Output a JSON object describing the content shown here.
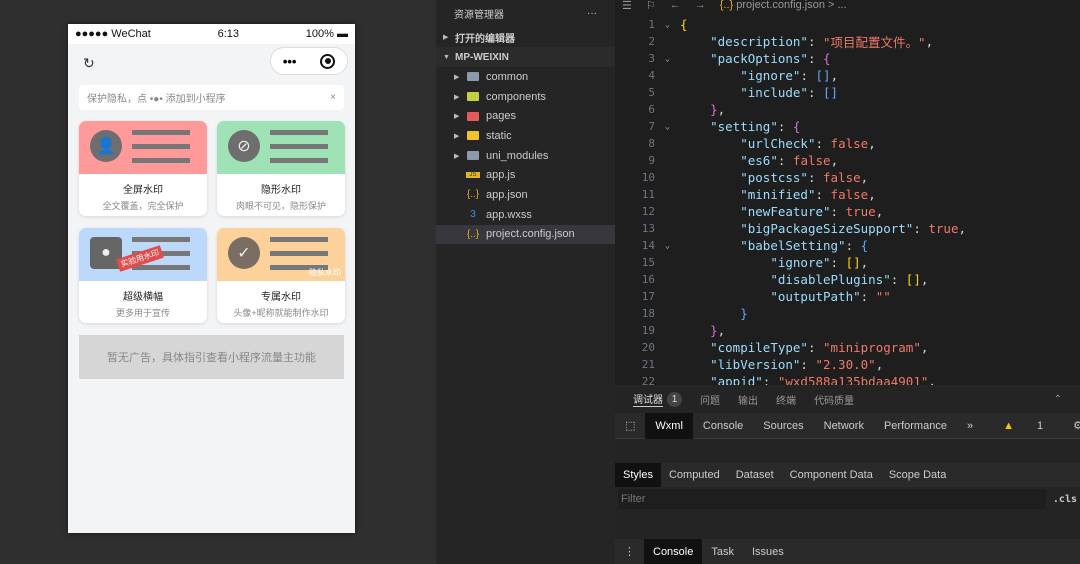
{
  "phone": {
    "status": {
      "signal": "●●●●● WeChat",
      "time": "6:13",
      "battery": "100%"
    },
    "capsule": {
      "more": "•••"
    },
    "tip": {
      "text": "保护隐私，点 •●• 添加到小程序",
      "close": "×"
    },
    "cards": [
      {
        "title": "全屏水印",
        "subtitle": "全文覆盖，完全保护",
        "color": "#ff9a9a"
      },
      {
        "title": "隐形水印",
        "subtitle": "肉眼不可见，隐形保护",
        "color": "#9fe2b6"
      },
      {
        "title": "超级横幅",
        "subtitle": "更多用于宣传",
        "color": "#bcd9fb",
        "stamp": "实验用水印"
      },
      {
        "title": "专属水印",
        "subtitle": "头像+昵称就能制作水印",
        "color": "#fcd29a",
        "watermark": "隐私水印"
      }
    ],
    "ad": "暂无广告，具体指引查看小程序流量主功能"
  },
  "explorer": {
    "title": "资源管理器",
    "more": "···",
    "open_editors": "打开的编辑器",
    "project": "MP-WEIXIN",
    "items": [
      {
        "name": "common",
        "type": "folder",
        "color": "#8a9aab"
      },
      {
        "name": "components",
        "type": "folder",
        "color": "#c5d03c"
      },
      {
        "name": "pages",
        "type": "folder",
        "color": "#e25a5a"
      },
      {
        "name": "static",
        "type": "folder",
        "color": "#f2c12e"
      },
      {
        "name": "uni_modules",
        "type": "folder",
        "color": "#8a9aab"
      },
      {
        "name": "app.js",
        "type": "js",
        "icon": "JS"
      },
      {
        "name": "app.json",
        "type": "json",
        "icon": "{..}"
      },
      {
        "name": "app.wxss",
        "type": "css",
        "icon": "3"
      },
      {
        "name": "project.config.json",
        "type": "json",
        "icon": "{..}",
        "selected": true
      }
    ]
  },
  "editor": {
    "breadcrumb": "project.config.json",
    "breadcrumb_more": "> ...",
    "icon": "{..}",
    "lines": [
      [
        [
          "b1",
          "{"
        ]
      ],
      [
        [
          "p",
          "    "
        ],
        [
          "k",
          "\"description\""
        ],
        [
          "p",
          ": "
        ],
        [
          "str",
          "\"项目配置文件。\""
        ],
        [
          "p",
          ","
        ]
      ],
      [
        [
          "p",
          "    "
        ],
        [
          "k",
          "\"packOptions\""
        ],
        [
          "p",
          ": "
        ],
        [
          "b2",
          "{"
        ]
      ],
      [
        [
          "p",
          "        "
        ],
        [
          "k",
          "\"ignore\""
        ],
        [
          "p",
          ": "
        ],
        [
          "b3",
          "[]"
        ],
        [
          "p",
          ","
        ]
      ],
      [
        [
          "p",
          "        "
        ],
        [
          "k",
          "\"include\""
        ],
        [
          "p",
          ": "
        ],
        [
          "b3",
          "[]"
        ]
      ],
      [
        [
          "p",
          "    "
        ],
        [
          "b2",
          "}"
        ],
        [
          "p",
          ","
        ]
      ],
      [
        [
          "p",
          "    "
        ],
        [
          "k",
          "\"setting\""
        ],
        [
          "p",
          ": "
        ],
        [
          "b2",
          "{"
        ]
      ],
      [
        [
          "p",
          "        "
        ],
        [
          "k",
          "\"urlCheck\""
        ],
        [
          "p",
          ": "
        ],
        [
          "kw",
          "false"
        ],
        [
          "p",
          ","
        ]
      ],
      [
        [
          "p",
          "        "
        ],
        [
          "k",
          "\"es6\""
        ],
        [
          "p",
          ": "
        ],
        [
          "kw",
          "false"
        ],
        [
          "p",
          ","
        ]
      ],
      [
        [
          "p",
          "        "
        ],
        [
          "k",
          "\"postcss\""
        ],
        [
          "p",
          ": "
        ],
        [
          "kw",
          "false"
        ],
        [
          "p",
          ","
        ]
      ],
      [
        [
          "p",
          "        "
        ],
        [
          "k",
          "\"minified\""
        ],
        [
          "p",
          ": "
        ],
        [
          "kw",
          "false"
        ],
        [
          "p",
          ","
        ]
      ],
      [
        [
          "p",
          "        "
        ],
        [
          "k",
          "\"newFeature\""
        ],
        [
          "p",
          ": "
        ],
        [
          "kw",
          "true"
        ],
        [
          "p",
          ","
        ]
      ],
      [
        [
          "p",
          "        "
        ],
        [
          "k",
          "\"bigPackageSizeSupport\""
        ],
        [
          "p",
          ": "
        ],
        [
          "kw",
          "true"
        ],
        [
          "p",
          ","
        ]
      ],
      [
        [
          "p",
          "        "
        ],
        [
          "k",
          "\"babelSetting\""
        ],
        [
          "p",
          ": "
        ],
        [
          "b3",
          "{"
        ]
      ],
      [
        [
          "p",
          "            "
        ],
        [
          "k",
          "\"ignore\""
        ],
        [
          "p",
          ": "
        ],
        [
          "b1",
          "[]"
        ],
        [
          "p",
          ","
        ]
      ],
      [
        [
          "p",
          "            "
        ],
        [
          "k",
          "\"disablePlugins\""
        ],
        [
          "p",
          ": "
        ],
        [
          "b1",
          "[]"
        ],
        [
          "p",
          ","
        ]
      ],
      [
        [
          "p",
          "            "
        ],
        [
          "k",
          "\"outputPath\""
        ],
        [
          "p",
          ": "
        ],
        [
          "str",
          "\"\""
        ]
      ],
      [
        [
          "p",
          "        "
        ],
        [
          "b3",
          "}"
        ]
      ],
      [
        [
          "p",
          "    "
        ],
        [
          "b2",
          "}"
        ],
        [
          "p",
          ","
        ]
      ],
      [
        [
          "p",
          "    "
        ],
        [
          "k",
          "\"compileType\""
        ],
        [
          "p",
          ": "
        ],
        [
          "str",
          "\"miniprogram\""
        ],
        [
          "p",
          ","
        ]
      ],
      [
        [
          "p",
          "    "
        ],
        [
          "k",
          "\"libVersion\""
        ],
        [
          "p",
          ": "
        ],
        [
          "str",
          "\"2.30.0\""
        ],
        [
          "p",
          ","
        ]
      ],
      [
        [
          "p",
          "    "
        ],
        [
          "k",
          "\"appid\""
        ],
        [
          "p",
          ": "
        ],
        [
          "str",
          "\"wxd588a135bdaa4901\""
        ],
        [
          "p",
          ","
        ]
      ]
    ],
    "folded_lines": [
      1,
      3,
      7,
      14
    ]
  },
  "debugger": {
    "tabs": [
      "调试器",
      "问题",
      "输出",
      "终端",
      "代码质量"
    ],
    "badge": "1",
    "devtools_tabs": [
      "Wxml",
      "Console",
      "Sources",
      "Network",
      "Performance"
    ],
    "overflow": "»",
    "warnings": "1",
    "style_tabs": [
      "Styles",
      "Computed",
      "Dataset",
      "Component Data",
      "Scope Data"
    ],
    "filter_placeholder": "Filter",
    "cls": ".cls",
    "drawer_tabs": [
      "Console",
      "Task",
      "Issues"
    ]
  }
}
